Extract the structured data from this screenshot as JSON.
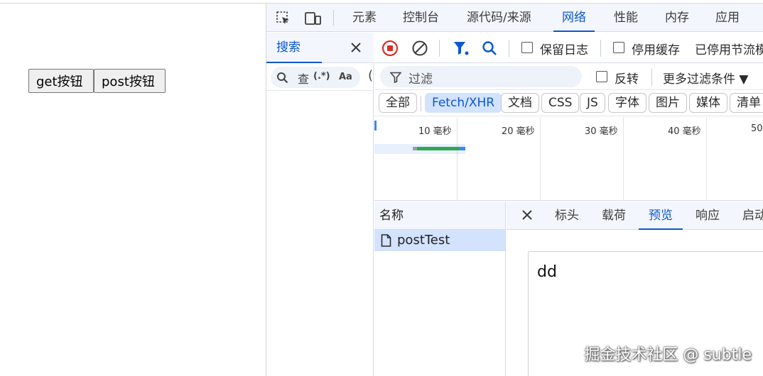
{
  "page": {
    "buttons": {
      "get_label": "get按钮",
      "post_label": "post按钮"
    }
  },
  "devtools": {
    "toolbar_icons": [
      "inspect-element-icon",
      "device-toggle-icon"
    ],
    "tabs": [
      {
        "label": "元素",
        "active": false
      },
      {
        "label": "控制台",
        "active": false
      },
      {
        "label": "源代码/来源",
        "active": false
      },
      {
        "label": "网络",
        "active": true
      },
      {
        "label": "性能",
        "active": false
      },
      {
        "label": "内存",
        "active": false
      },
      {
        "label": "应用",
        "active": false
      }
    ],
    "search": {
      "tab_label": "搜索",
      "input_text": "查",
      "regex_label": "(.*)",
      "case_label": "Aa",
      "overflow_char": "("
    },
    "network": {
      "toolbar": {
        "preserve_log_label": "保留日志",
        "disable_cache_label": "停用缓存",
        "throttle_label": "已停用节流模"
      },
      "filter": {
        "placeholder": "过滤",
        "invert_label": "反转",
        "more_filters_label": "更多过滤条件 ▼"
      },
      "type_filters": [
        {
          "label": "全部",
          "active": false
        },
        {
          "label": "Fetch/XHR",
          "active": true
        },
        {
          "label": "文档",
          "active": false
        },
        {
          "label": "CSS",
          "active": false
        },
        {
          "label": "JS",
          "active": false
        },
        {
          "label": "字体",
          "active": false
        },
        {
          "label": "图片",
          "active": false
        },
        {
          "label": "媒体",
          "active": false
        },
        {
          "label": "清单",
          "active": false
        }
      ],
      "overview_ticks": [
        "10 毫秒",
        "20 毫秒",
        "30 毫秒",
        "40 毫秒",
        "50"
      ],
      "list": {
        "header": "名称",
        "rows": [
          {
            "name": "postTest"
          }
        ]
      },
      "detail": {
        "tabs": [
          {
            "label": "标头",
            "active": false
          },
          {
            "label": "载荷",
            "active": false
          },
          {
            "label": "预览",
            "active": true
          },
          {
            "label": "响应",
            "active": false
          },
          {
            "label": "启动",
            "active": false
          }
        ],
        "preview_text": "dd"
      }
    }
  },
  "watermark": "掘金技术社区 @ subtle",
  "colors": {
    "accent": "#0b57d0",
    "record": "#d93025",
    "chip_active": "#d3e3fd",
    "bar_green": "#2fa84f"
  }
}
